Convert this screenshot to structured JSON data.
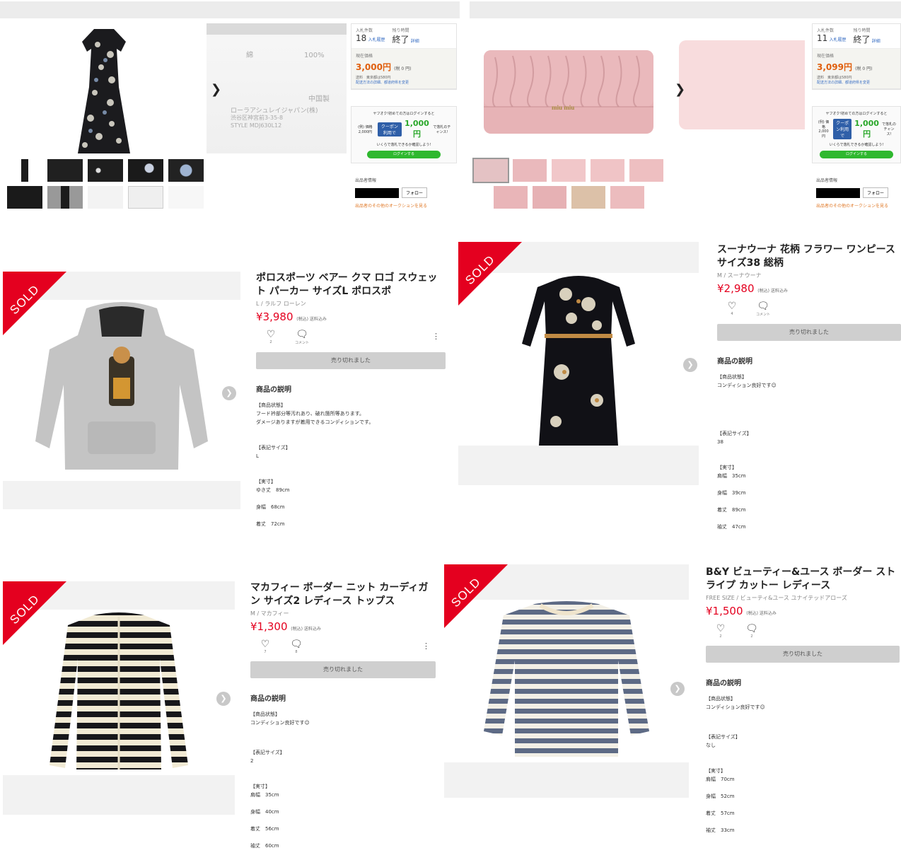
{
  "auctions": [
    {
      "bids_label": "入札件数",
      "bids": "18",
      "bids_link": "入札履歴",
      "remaining_label": "残り時間",
      "remaining": "終了",
      "detail_link": "詳細",
      "price_label": "現在価格",
      "price": "3,000円",
      "tax": "(税 0 円)",
      "ship": "送料　東京都は580円",
      "ship_link": "配送方法の詳細、都道府県を変更",
      "label_lines": [
        "綿",
        "100%",
        "中国製",
        "ローラアシュレイジャパン(株)",
        "渋谷区神宮前3-35-8",
        "STYLE MDJ630L12"
      ],
      "login_text": "ヤフオク!初めての方はログインすると",
      "coupon_prefix": "(例) 価格2,000円",
      "coupon_tag": "クーポン利用で",
      "coupon_amount": "1,000円",
      "coupon_suffix": "で落札のチャンス!",
      "login_sub": "いくらで落札できるか確認しよう!",
      "login_button": "ログインする",
      "seller_label": "出品者情報",
      "follow": "フォロー",
      "other_link": "出品者のその他のオークションを見る"
    },
    {
      "bids_label": "入札件数",
      "bids": "11",
      "bids_link": "入札履歴",
      "remaining_label": "残り時間",
      "remaining": "終了",
      "detail_link": "詳細",
      "price_label": "現在価格",
      "price": "3,099円",
      "tax": "(税 0 円)",
      "ship": "送料　東京都は580円",
      "ship_link": "配送方法の詳細、都道府県を変更",
      "brand_plate": "miu miu",
      "login_text": "ヤフオク!初めての方はログインすると",
      "coupon_prefix": "(例) 価格2,000円",
      "coupon_tag": "クーポン利用で",
      "coupon_amount": "1,000円",
      "coupon_suffix": "で落札のチャンス!",
      "login_sub": "いくらで落札できるか確認しよう!",
      "login_button": "ログインする",
      "seller_label": "出品者情報",
      "follow": "フォロー",
      "other_link": "出品者のその他のオークションを見る"
    }
  ],
  "listings": [
    {
      "sold": "SOLD",
      "title": "ポロスポーツ ベアー クマ ロゴ スウェット パーカー サイズL ポロスポ",
      "sub": "L / ラルフ ローレン",
      "price": "¥3,980",
      "price_note": "(税込) 送料込み",
      "likes": "2",
      "comments_label": "コメント",
      "soldout": "売り切れました",
      "desc_head": "商品の説明",
      "desc": "【商品状態】\nフード衿部分等汚れあり、破れ箇所等あります。\nダメージありますが着用できるコンディションです。",
      "size_head": "【表記サイズ】",
      "size": "L",
      "measure_head": "【実寸】",
      "measures": [
        "ゆき丈　89cm",
        "身幅　68cm",
        "着丈　72cm"
      ]
    },
    {
      "sold": "SOLD",
      "title": "スーナウーナ 花柄 フラワー ワンピース サイズ38 総柄",
      "sub": "M / スーナウーナ",
      "price": "¥2,980",
      "price_note": "(税込) 送料込み",
      "likes": "4",
      "comments_label": "コメント",
      "soldout": "売り切れました",
      "desc_head": "商品の説明",
      "desc": "【商品状態】\nコンディション良好です☺",
      "size_head": "【表記サイズ】",
      "size": "38",
      "measure_head": "【実寸】",
      "measures": [
        "肩幅　35cm",
        "身幅　39cm",
        "着丈　89cm",
        "袖丈　47cm"
      ]
    },
    {
      "sold": "SOLD",
      "title": "マカフィー ボーダー ニット カーディガン サイズ2 レディース トップス",
      "sub": "M / マカフィー",
      "price": "¥1,300",
      "price_note": "(税込) 送料込み",
      "likes": "7",
      "comments": "8",
      "soldout": "売り切れました",
      "desc_head": "商品の説明",
      "desc": "【商品状態】\nコンディション良好です☺",
      "size_head": "【表記サイズ】",
      "size": "2",
      "measure_head": "【実寸】",
      "measures": [
        "肩幅　35cm",
        "身幅　40cm",
        "着丈　56cm",
        "袖丈　60cm"
      ]
    },
    {
      "sold": "SOLD",
      "title": "B&Y ビューティー&ユース ボーダー ストライプ カットー レディース",
      "sub": "FREE SIZE / ビューティ&ユース ユナイテッドアローズ",
      "price": "¥1,500",
      "price_note": "(税込) 送料込み",
      "likes": "2",
      "comments": "2",
      "soldout": "売り切れました",
      "desc_head": "商品の説明",
      "desc": "【商品状態】\nコンディション良好です☺",
      "size_head": "【表記サイズ】",
      "size": "なし",
      "measure_head": "【実寸】",
      "measures": [
        "肩幅　70cm",
        "身幅　52cm",
        "着丈　57cm",
        "袖丈　33cm"
      ]
    }
  ]
}
